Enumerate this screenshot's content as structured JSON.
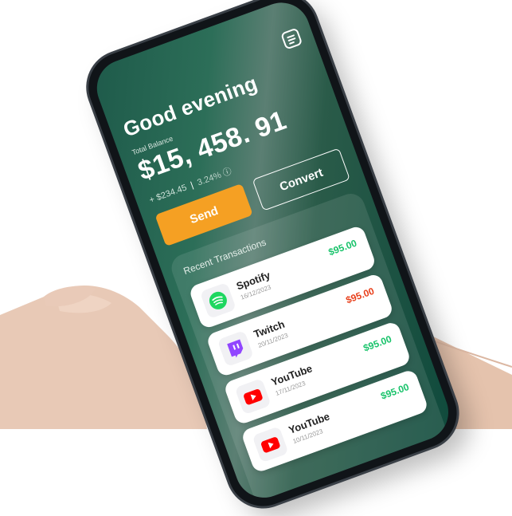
{
  "colors": {
    "screen_green": "#1e5a4a",
    "accent_orange": "#f5a023",
    "positive_green": "#19c36b",
    "negative_red": "#e8401c",
    "spotify_green": "#1ed760",
    "twitch_purple": "#9146ff",
    "youtube_red": "#ff0000"
  },
  "header": {
    "greeting": "Good evening",
    "menu_icon": "menu-icon"
  },
  "balance": {
    "label": "Total Balance",
    "amount": "$15, 458. 91",
    "change": "+ $234.45",
    "change_pct": "3.24%"
  },
  "actions": {
    "send_label": "Send",
    "convert_label": "Convert"
  },
  "transactions": {
    "title": "Recent Transactions",
    "items": [
      {
        "name": "Spotify",
        "date": "16/12/2023",
        "amount": "$95.00",
        "status": "positive",
        "icon": "spotify-icon"
      },
      {
        "name": "Twitch",
        "date": "20/11/2023",
        "amount": "$95.00",
        "status": "negative",
        "icon": "twitch-icon"
      },
      {
        "name": "YouTube",
        "date": "17/11/2023",
        "amount": "$95.00",
        "status": "positive",
        "icon": "youtube-icon"
      },
      {
        "name": "YouTube",
        "date": "10/11/2023",
        "amount": "$95.00",
        "status": "positive",
        "icon": "youtube-icon"
      }
    ]
  }
}
